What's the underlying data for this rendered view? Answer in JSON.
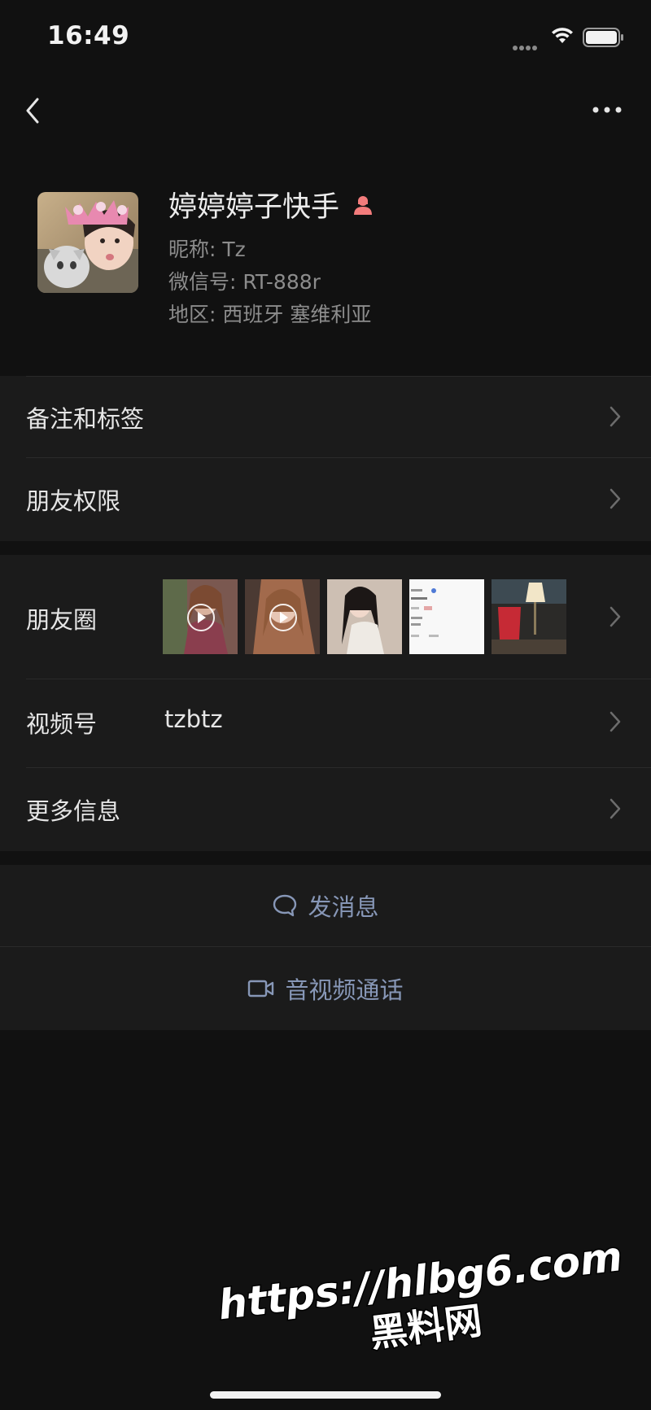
{
  "status_bar": {
    "time": "16:49"
  },
  "profile": {
    "name": "婷婷婷子快手",
    "nickname": "昵称: Tz",
    "wechat_id": "微信号: RT-888r",
    "region": "地区: 西班牙 塞维利亚",
    "gender_icon": "female-icon",
    "gender_color": "#f37c7c"
  },
  "menu": {
    "remark": "备注和标签",
    "permissions": "朋友权限"
  },
  "details": {
    "moments_label": "朋友圈",
    "channels_label": "视频号",
    "channels_value": "tzbtz",
    "more_info_label": "更多信息"
  },
  "actions": {
    "message": "发消息",
    "call": "音视频通话",
    "action_color": "#8797b7"
  },
  "watermark": {
    "url": "https://hlbg6.com",
    "site": "黑料网"
  }
}
